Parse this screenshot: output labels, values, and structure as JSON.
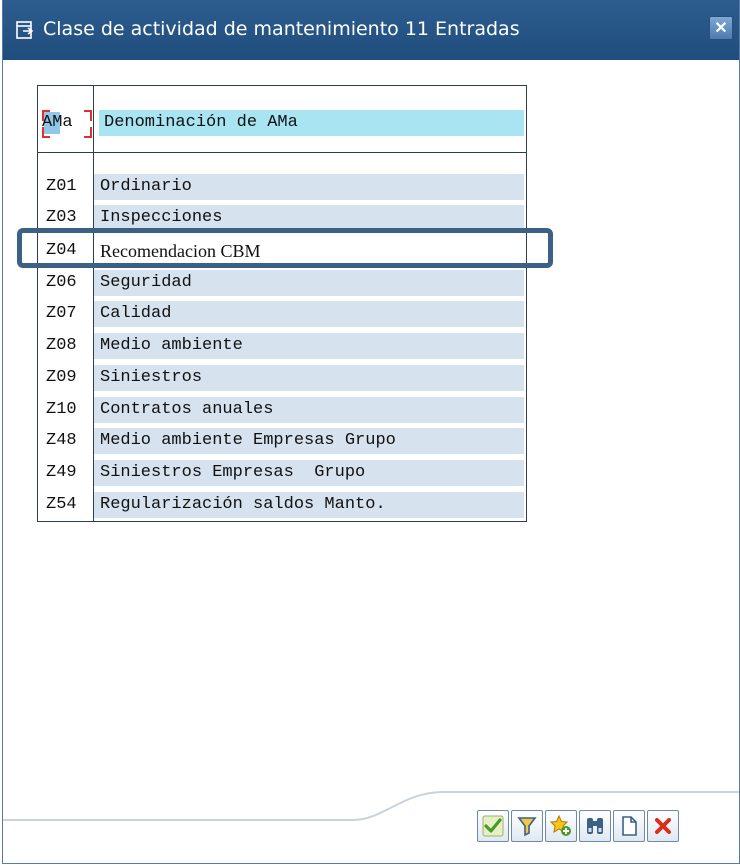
{
  "window": {
    "title": "Clase de actividad de mantenimiento 11 Entradas",
    "close_label": "✕"
  },
  "list": {
    "header": {
      "key": "AMa",
      "name": "Denominación de AMa"
    },
    "rows": [
      {
        "key": "Z01",
        "name": "Ordinario"
      },
      {
        "key": "Z03",
        "name": "Inspecciones"
      },
      {
        "key": "Z04",
        "name": "Recomendacion CBM"
      },
      {
        "key": "Z06",
        "name": "Seguridad"
      },
      {
        "key": "Z07",
        "name": "Calidad"
      },
      {
        "key": "Z08",
        "name": "Medio ambiente"
      },
      {
        "key": "Z09",
        "name": "Siniestros"
      },
      {
        "key": "Z10",
        "name": "Contratos anuales"
      },
      {
        "key": "Z48",
        "name": "Medio ambiente Empresas Grupo"
      },
      {
        "key": "Z49",
        "name": "Siniestros Empresas  Grupo"
      },
      {
        "key": "Z54",
        "name": "Regularización saldos Manto."
      }
    ],
    "highlighted_row": "Z04"
  },
  "toolbar": {
    "buttons": [
      "check-icon",
      "filter-icon",
      "star-add-icon",
      "binoculars-icon",
      "new-document-icon",
      "cancel-icon"
    ]
  },
  "colors": {
    "title_bar": "#1f4d7d",
    "row_fill": "#d7e2ef",
    "header_fill": "#a9e4f2",
    "highlight_border": "#3b6185",
    "confirm_green": "#4a9a2a",
    "cancel_red": "#d9301c"
  }
}
